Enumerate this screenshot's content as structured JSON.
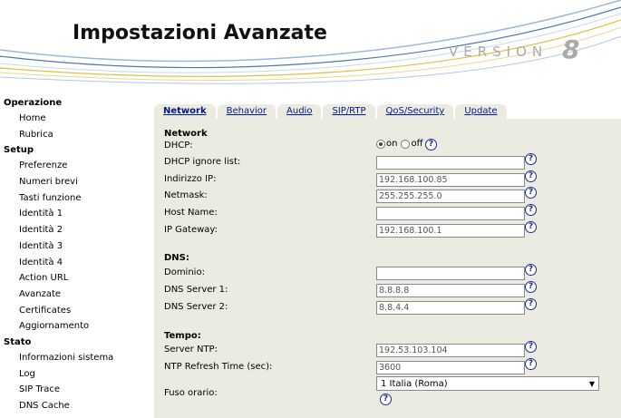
{
  "header": {
    "title": "Impostazioni Avanzate",
    "version_label": "VERSION",
    "version_number": "8"
  },
  "sidebar": {
    "sections": [
      {
        "title": "Operazione",
        "items": [
          "Home",
          "Rubrica"
        ]
      },
      {
        "title": "Setup",
        "items": [
          "Preferenze",
          "Numeri brevi",
          "Tasti funzione",
          "Identità 1",
          "Identità 2",
          "Identità 3",
          "Identità 4",
          "Action URL",
          "Avanzate",
          "Certificates",
          "Aggiornamento"
        ]
      },
      {
        "title": "Stato",
        "items": [
          "Informazioni sistema",
          "Log",
          "SIP Trace",
          "DNS Cache"
        ]
      }
    ]
  },
  "tabs": [
    "Network",
    "Behavior",
    "Audio",
    "SIP/RTP",
    "QoS/Security",
    "Update"
  ],
  "network": {
    "heading": "Network",
    "dhcp_label": "DHCP:",
    "dhcp_on": "on",
    "dhcp_off": "off",
    "dhcp_ignore_label": "DHCP ignore list:",
    "dhcp_ignore_value": "",
    "ip_label": "Indirizzo IP:",
    "ip_value": "192.168.100.85",
    "netmask_label": "Netmask:",
    "netmask_value": "255.255.255.0",
    "hostname_label": "Host Name:",
    "hostname_value": "",
    "gateway_label": "IP Gateway:",
    "gateway_value": "192.168.100.1"
  },
  "dns": {
    "heading": "DNS:",
    "domain_label": "Dominio:",
    "domain_value": "",
    "dns1_label": "DNS Server 1:",
    "dns1_value": "8.8.8.8",
    "dns2_label": "DNS Server 2:",
    "dns2_value": "8.8.4.4"
  },
  "time": {
    "heading": "Tempo:",
    "ntp_label": "Server NTP:",
    "ntp_value": "192.53.103.104",
    "refresh_label": "NTP Refresh Time (sec):",
    "refresh_value": "3600",
    "tz_label": "Fuso orario:",
    "tz_value": "1 Italia (Roma)"
  },
  "help_glyph": "?",
  "colors": {
    "panel_bg": "#ecebe2",
    "link": "#001a8c",
    "help": "#1b2a9a"
  }
}
